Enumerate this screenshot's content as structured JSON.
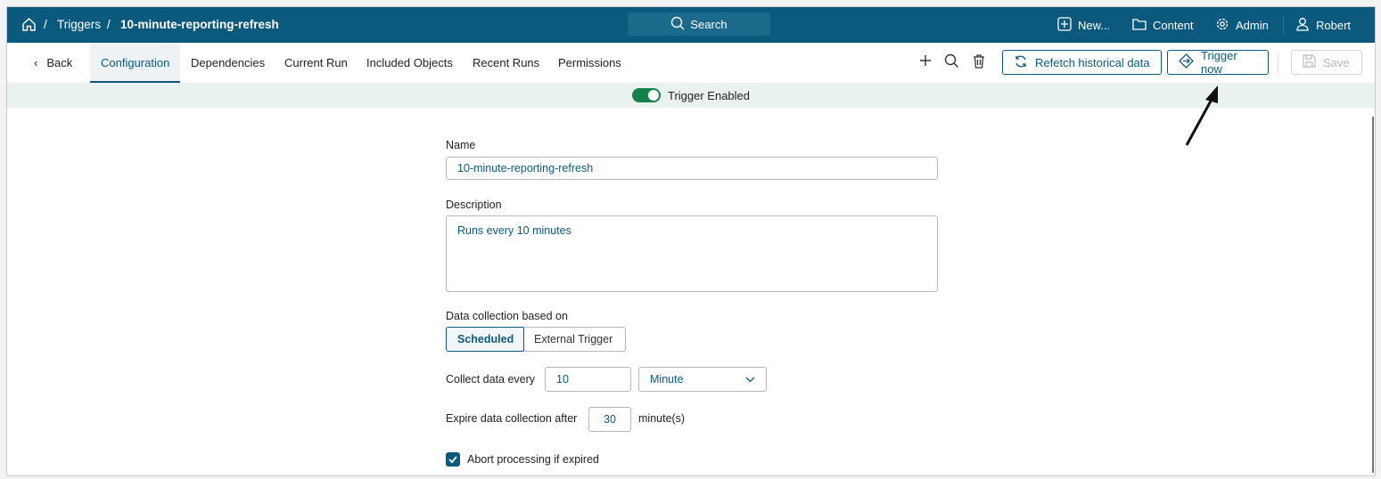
{
  "header": {
    "breadcrumb": [
      "Triggers",
      "10-minute-reporting-refresh"
    ],
    "search_label": "Search",
    "new_label": "New...",
    "content_label": "Content",
    "admin_label": "Admin",
    "user_label": "Robert"
  },
  "tabs": {
    "back": "Back",
    "items": [
      "Configuration",
      "Dependencies",
      "Current Run",
      "Included Objects",
      "Recent Runs",
      "Permissions"
    ],
    "active": "Configuration"
  },
  "toolbar": {
    "refetch_label": "Refetch historical data",
    "trigger_label": "Trigger now",
    "save_label": "Save"
  },
  "banner": {
    "label": "Trigger Enabled",
    "enabled": true
  },
  "form": {
    "name_label": "Name",
    "name_value": "10-minute-reporting-refresh",
    "description_label": "Description",
    "description_value": "Runs every 10 minutes",
    "based_on_label": "Data collection based on",
    "based_on_options": [
      "Scheduled",
      "External Trigger"
    ],
    "based_on_selected": "Scheduled",
    "collect_label": "Collect data every",
    "collect_value": "10",
    "collect_unit": "Minute",
    "expire_label": "Expire data collection after",
    "expire_value": "30",
    "expire_unit": "minute(s)",
    "abort_label": "Abort processing if expired",
    "abort_checked": true
  },
  "colors": {
    "brand": "#0b5a7e",
    "toggle": "#14804a"
  }
}
